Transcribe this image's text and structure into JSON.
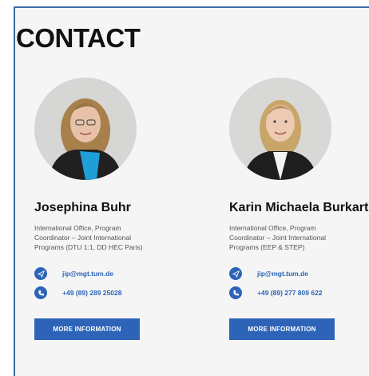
{
  "page": {
    "title": "CONTACT"
  },
  "contacts": [
    {
      "name": "Josephina Buhr",
      "role": "International Office, Program Coordinator – Joint International Programs (DTU 1:1, DD HEC Paris)",
      "email": "jip@mgt.tum.de",
      "phone": "+49 (89) 289 25028",
      "button_label": "MORE INFORMATION"
    },
    {
      "name": "Karin Michaela Burkart",
      "role": "International Office, Program Coordinator – Joint International Programs (EEP & STEP)",
      "email": "jip@mgt.tum.de",
      "phone": "+49 (89) 277 809 622",
      "button_label": "MORE INFORMATION"
    }
  ],
  "icons": {
    "email": "send-icon",
    "phone": "phone-icon"
  },
  "colors": {
    "accent": "#2d64b8",
    "border": "#3d6da6",
    "background": "#f5f5f5"
  }
}
